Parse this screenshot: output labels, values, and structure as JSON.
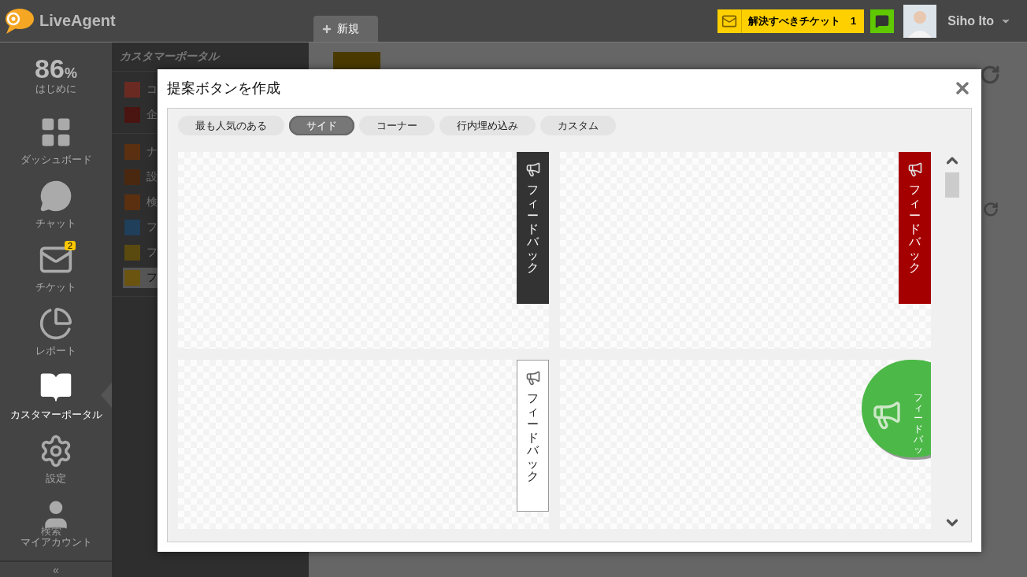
{
  "header": {
    "logo": "LiveAgent",
    "tabs": [
      {
        "label": "新規",
        "selected": true
      }
    ],
    "ticket_button": {
      "label": "解決すべきチケット",
      "count": "1"
    },
    "user": {
      "name": "Siho Ito"
    }
  },
  "sidebar": {
    "progress": {
      "value": "86",
      "unit": "%",
      "label": "はじめに"
    },
    "items": [
      {
        "label": "ダッシュボード",
        "selected": false
      },
      {
        "label": "チャット",
        "selected": false
      },
      {
        "label": "チケット",
        "badge": "2",
        "selected": false
      },
      {
        "label": "レポート",
        "selected": false
      },
      {
        "label": "カスタマーポータル",
        "selected": true
      },
      {
        "label": "設定",
        "selected": false
      },
      {
        "label": "マイアカウント",
        "overlay": "検索",
        "selected": false
      }
    ],
    "collapse": "«"
  },
  "panel": {
    "title": "カスタマーポータル",
    "groups": [
      [
        {
          "label": "コ",
          "color": "#6a2a22",
          "selected": false
        },
        {
          "label": "企",
          "color": "#4a1410",
          "selected": false
        }
      ],
      [
        {
          "label": "ナ",
          "color": "#5a3010",
          "selected": false
        },
        {
          "label": "設",
          "color": "#4a2810",
          "selected": false
        },
        {
          "label": "検",
          "color": "#5a3010",
          "selected": false
        },
        {
          "label": "フ",
          "color": "#1f3f5a",
          "selected": false
        },
        {
          "label": "フ",
          "color": "#5a4a10",
          "selected": false
        },
        {
          "label": "フ",
          "color": "#6a5410",
          "selected": true
        }
      ]
    ]
  },
  "modal": {
    "title": "提案ボタンを作成",
    "tabs": [
      {
        "label": "最も人気のある",
        "selected": false
      },
      {
        "label": "サイド",
        "selected": true
      },
      {
        "label": "コーナー",
        "selected": false
      },
      {
        "label": "行内埋め込み",
        "selected": false
      },
      {
        "label": "カスタム",
        "selected": false
      }
    ],
    "previews": [
      {
        "kind": "tab",
        "color": "#333333",
        "text": "フィードバック"
      },
      {
        "kind": "tab",
        "color": "#a50000",
        "text": "フィードバック"
      },
      {
        "kind": "outline",
        "color": "#ffffff",
        "text": "フィードバック"
      },
      {
        "kind": "circle",
        "color": "#4cb848",
        "text": "フィードバッ"
      }
    ]
  }
}
